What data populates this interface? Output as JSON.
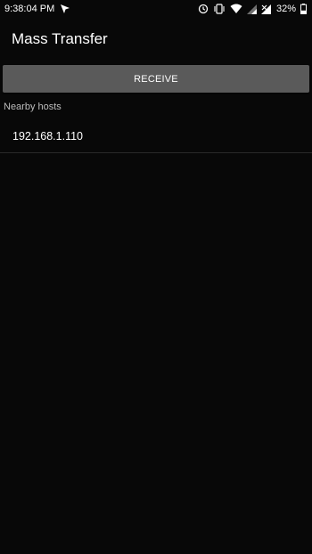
{
  "status_bar": {
    "time": "9:38:04 PM",
    "battery": "32%",
    "icons": [
      "location-arrow-icon",
      "sync-icon",
      "vibrate-icon",
      "wifi-icon",
      "signal-icon",
      "no-signal-icon"
    ]
  },
  "app_bar": {
    "title": "Mass Transfer"
  },
  "actions": {
    "receive_label": "RECEIVE"
  },
  "nearby": {
    "header": "Nearby hosts",
    "hosts": [
      {
        "address": "192.168.1.110"
      }
    ]
  },
  "colors": {
    "background": "#080808",
    "button": "#5a5a5a",
    "divider": "#2a2a2a",
    "secondary_text": "#bdbdbd"
  }
}
